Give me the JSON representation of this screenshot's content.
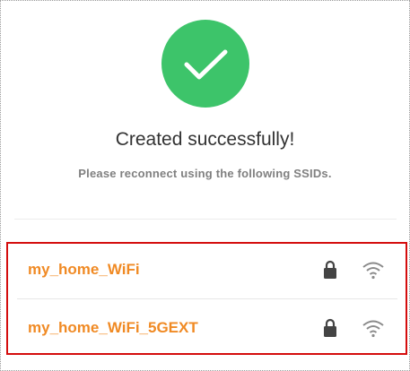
{
  "status": {
    "icon": "checkmark-circle-icon",
    "accent_color": "#3dc46a",
    "title": "Created successfully!",
    "message": "Please reconnect using the following SSIDs."
  },
  "ssids": [
    {
      "name": "my_home_WiFi",
      "secured": true,
      "lock_icon": "lock-icon",
      "signal_icon": "wifi-icon"
    },
    {
      "name": "my_home_WiFi_5GEXT",
      "secured": true,
      "lock_icon": "lock-icon",
      "signal_icon": "wifi-icon"
    }
  ],
  "colors": {
    "ssid_text": "#f08a24",
    "highlight_border": "#d40d0d"
  }
}
